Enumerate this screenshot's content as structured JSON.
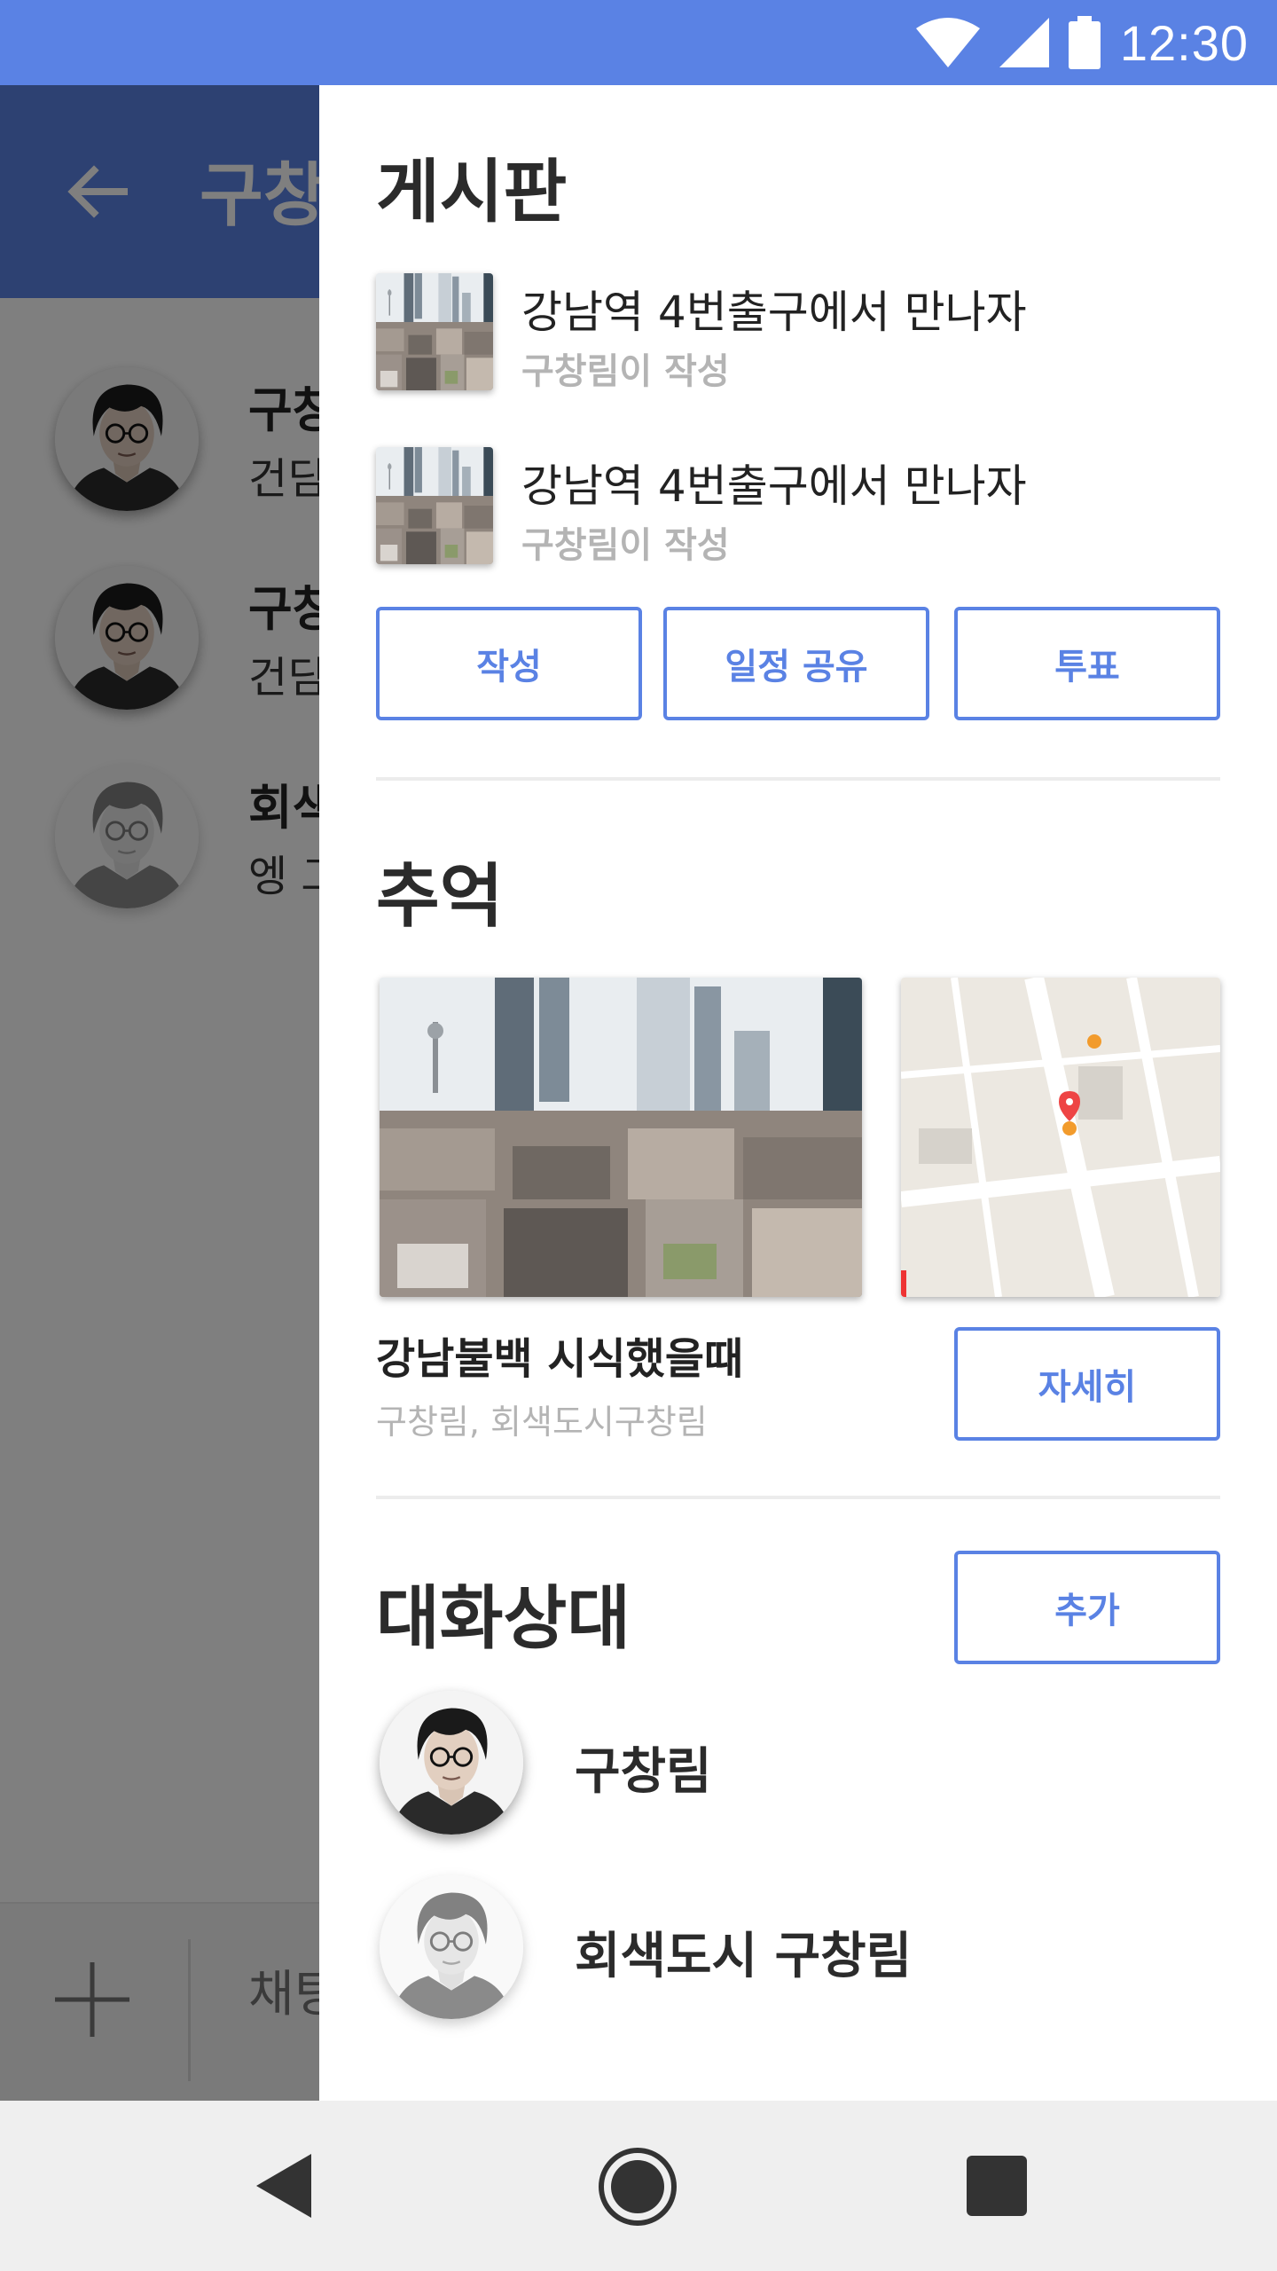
{
  "status_bar": {
    "time": "12:30",
    "icons": [
      "wifi-icon",
      "signal-icon",
      "battery-icon"
    ]
  },
  "chat": {
    "title": "구창림",
    "items": [
      {
        "name": "구창",
        "preview": "건딤"
      },
      {
        "name": "구창",
        "preview": "건딤"
      },
      {
        "name": "회색",
        "preview": "엥 그"
      }
    ],
    "input_placeholder": "채팅"
  },
  "drawer": {
    "board": {
      "title": "게시판",
      "posts": [
        {
          "title": "강남역 4번출구에서 만나자",
          "author": "구창림이 작성"
        },
        {
          "title": "강남역 4번출구에서 만나자",
          "author": "구창림이 작성"
        }
      ],
      "buttons": {
        "write": "작성",
        "schedule_share": "일정 공유",
        "vote": "투표"
      }
    },
    "memories": {
      "title": "추억",
      "memory_title": "강남불백 시식했을때",
      "members": "구창림, 회색도시구창림",
      "detail_button": "자세히"
    },
    "contacts": {
      "title": "대화상대",
      "add_button": "추가",
      "people": [
        {
          "name": "구창림"
        },
        {
          "name": "회색도시 구창림"
        }
      ]
    }
  },
  "colors": {
    "accent": "#5a82e4",
    "nav_bar": "#efefef",
    "muted_text": "#b4b4b4"
  }
}
